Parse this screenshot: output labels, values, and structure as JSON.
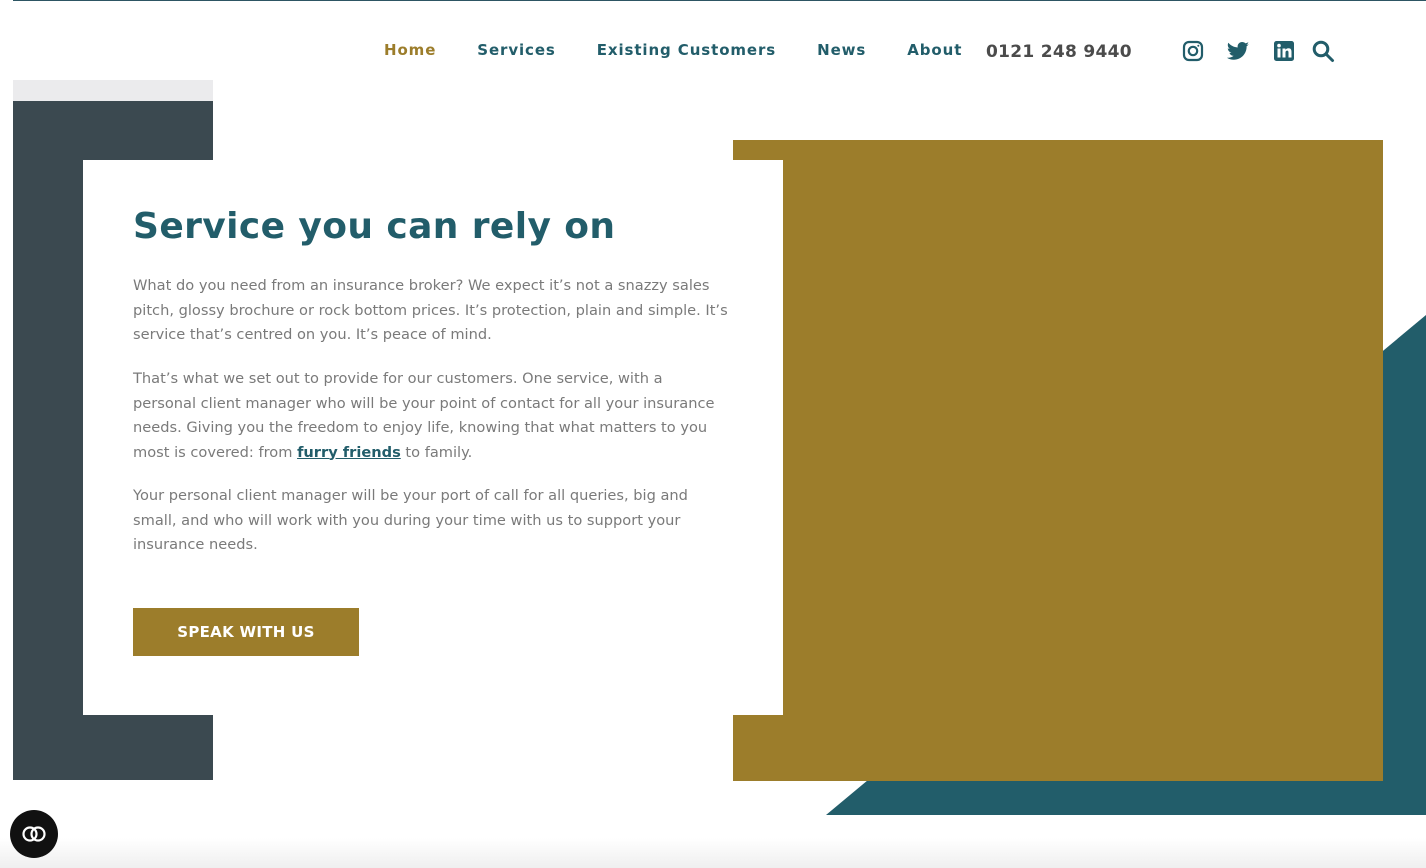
{
  "colors": {
    "brand_teal": "#225d6a",
    "brand_gold": "#9c7d2b",
    "slate": "#3b4950",
    "text_gray": "#7a7a7a"
  },
  "nav": {
    "items": [
      {
        "label": "Home",
        "active": true
      },
      {
        "label": "Services",
        "active": false
      },
      {
        "label": "Existing Customers",
        "active": false
      },
      {
        "label": "News",
        "active": false
      },
      {
        "label": "About",
        "active": false
      }
    ]
  },
  "header": {
    "phone": "0121 248 9440",
    "social_icons": [
      "instagram-icon",
      "twitter-icon",
      "linkedin-icon",
      "search-icon"
    ]
  },
  "hero": {
    "title": "Service you can rely on",
    "paragraph_1": "What do you need from an insurance broker? We expect it’s not a snazzy sales pitch, glossy brochure or rock bottom prices. It’s protection, plain and simple. It’s service that’s centred on you. It’s peace of mind.",
    "paragraph_2_before": "That’s what we set out to provide for our customers. One service, with a personal client manager who will be your point of contact for all your insurance needs. Giving you the freedom to enjoy life, knowing that what matters to you most is covered: from ",
    "paragraph_2_link": "furry friends",
    "paragraph_2_after": " to family.",
    "paragraph_3": "Your personal client manager will be your port of call for all queries, big and small, and who will work with you during your time with us to support your insurance needs.",
    "cta_label": "SPEAK WITH US"
  },
  "widgets": {
    "accessibility_icon": "accessibility-icon"
  }
}
